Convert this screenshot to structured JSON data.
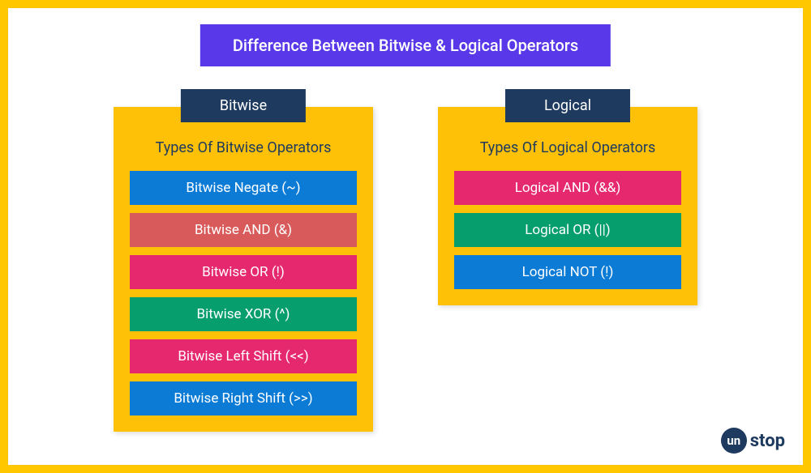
{
  "title": "Difference Between Bitwise & Logical Operators",
  "columns": [
    {
      "header": "Bitwise",
      "subtitle": "Types Of Bitwise Operators",
      "items": [
        {
          "label": "Bitwise Negate (~)",
          "color": "c-blue"
        },
        {
          "label": "Bitwise AND (&)",
          "color": "c-red"
        },
        {
          "label": "Bitwise OR (!)",
          "color": "c-pink"
        },
        {
          "label": "Bitwise XOR (^)",
          "color": "c-green"
        },
        {
          "label": "Bitwise Left Shift (<<)",
          "color": "c-pink"
        },
        {
          "label": "Bitwise Right Shift (>>)",
          "color": "c-blue"
        }
      ]
    },
    {
      "header": "Logical",
      "subtitle": "Types Of Logical Operators",
      "items": [
        {
          "label": "Logical AND (&&)",
          "color": "c-pink"
        },
        {
          "label": "Logical OR (||)",
          "color": "c-green"
        },
        {
          "label": "Logical NOT (!)",
          "color": "c-blue"
        }
      ]
    }
  ],
  "logo": {
    "circle": "un",
    "text": "stop"
  }
}
